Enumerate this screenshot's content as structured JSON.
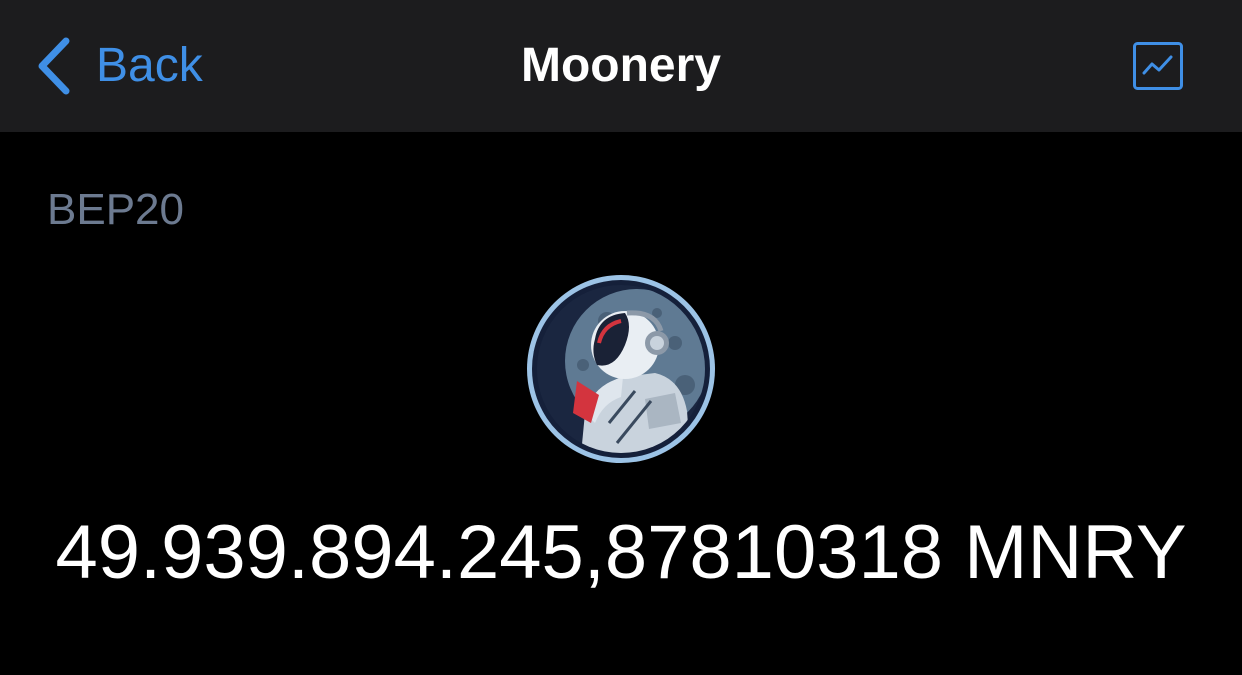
{
  "nav": {
    "back_label": "Back",
    "title": "Moonery",
    "chart_icon": "chart-line-icon",
    "accent_color": "#3f8fe6"
  },
  "token": {
    "network": "BEP20",
    "logo_icon": "astronaut-moon-logo",
    "balance": "49.939.894.245,87810318 MNRY"
  },
  "colors": {
    "background": "#000000",
    "navbar": "#1c1c1e",
    "network_text": "#6c7a90",
    "primary_text": "#ffffff"
  }
}
